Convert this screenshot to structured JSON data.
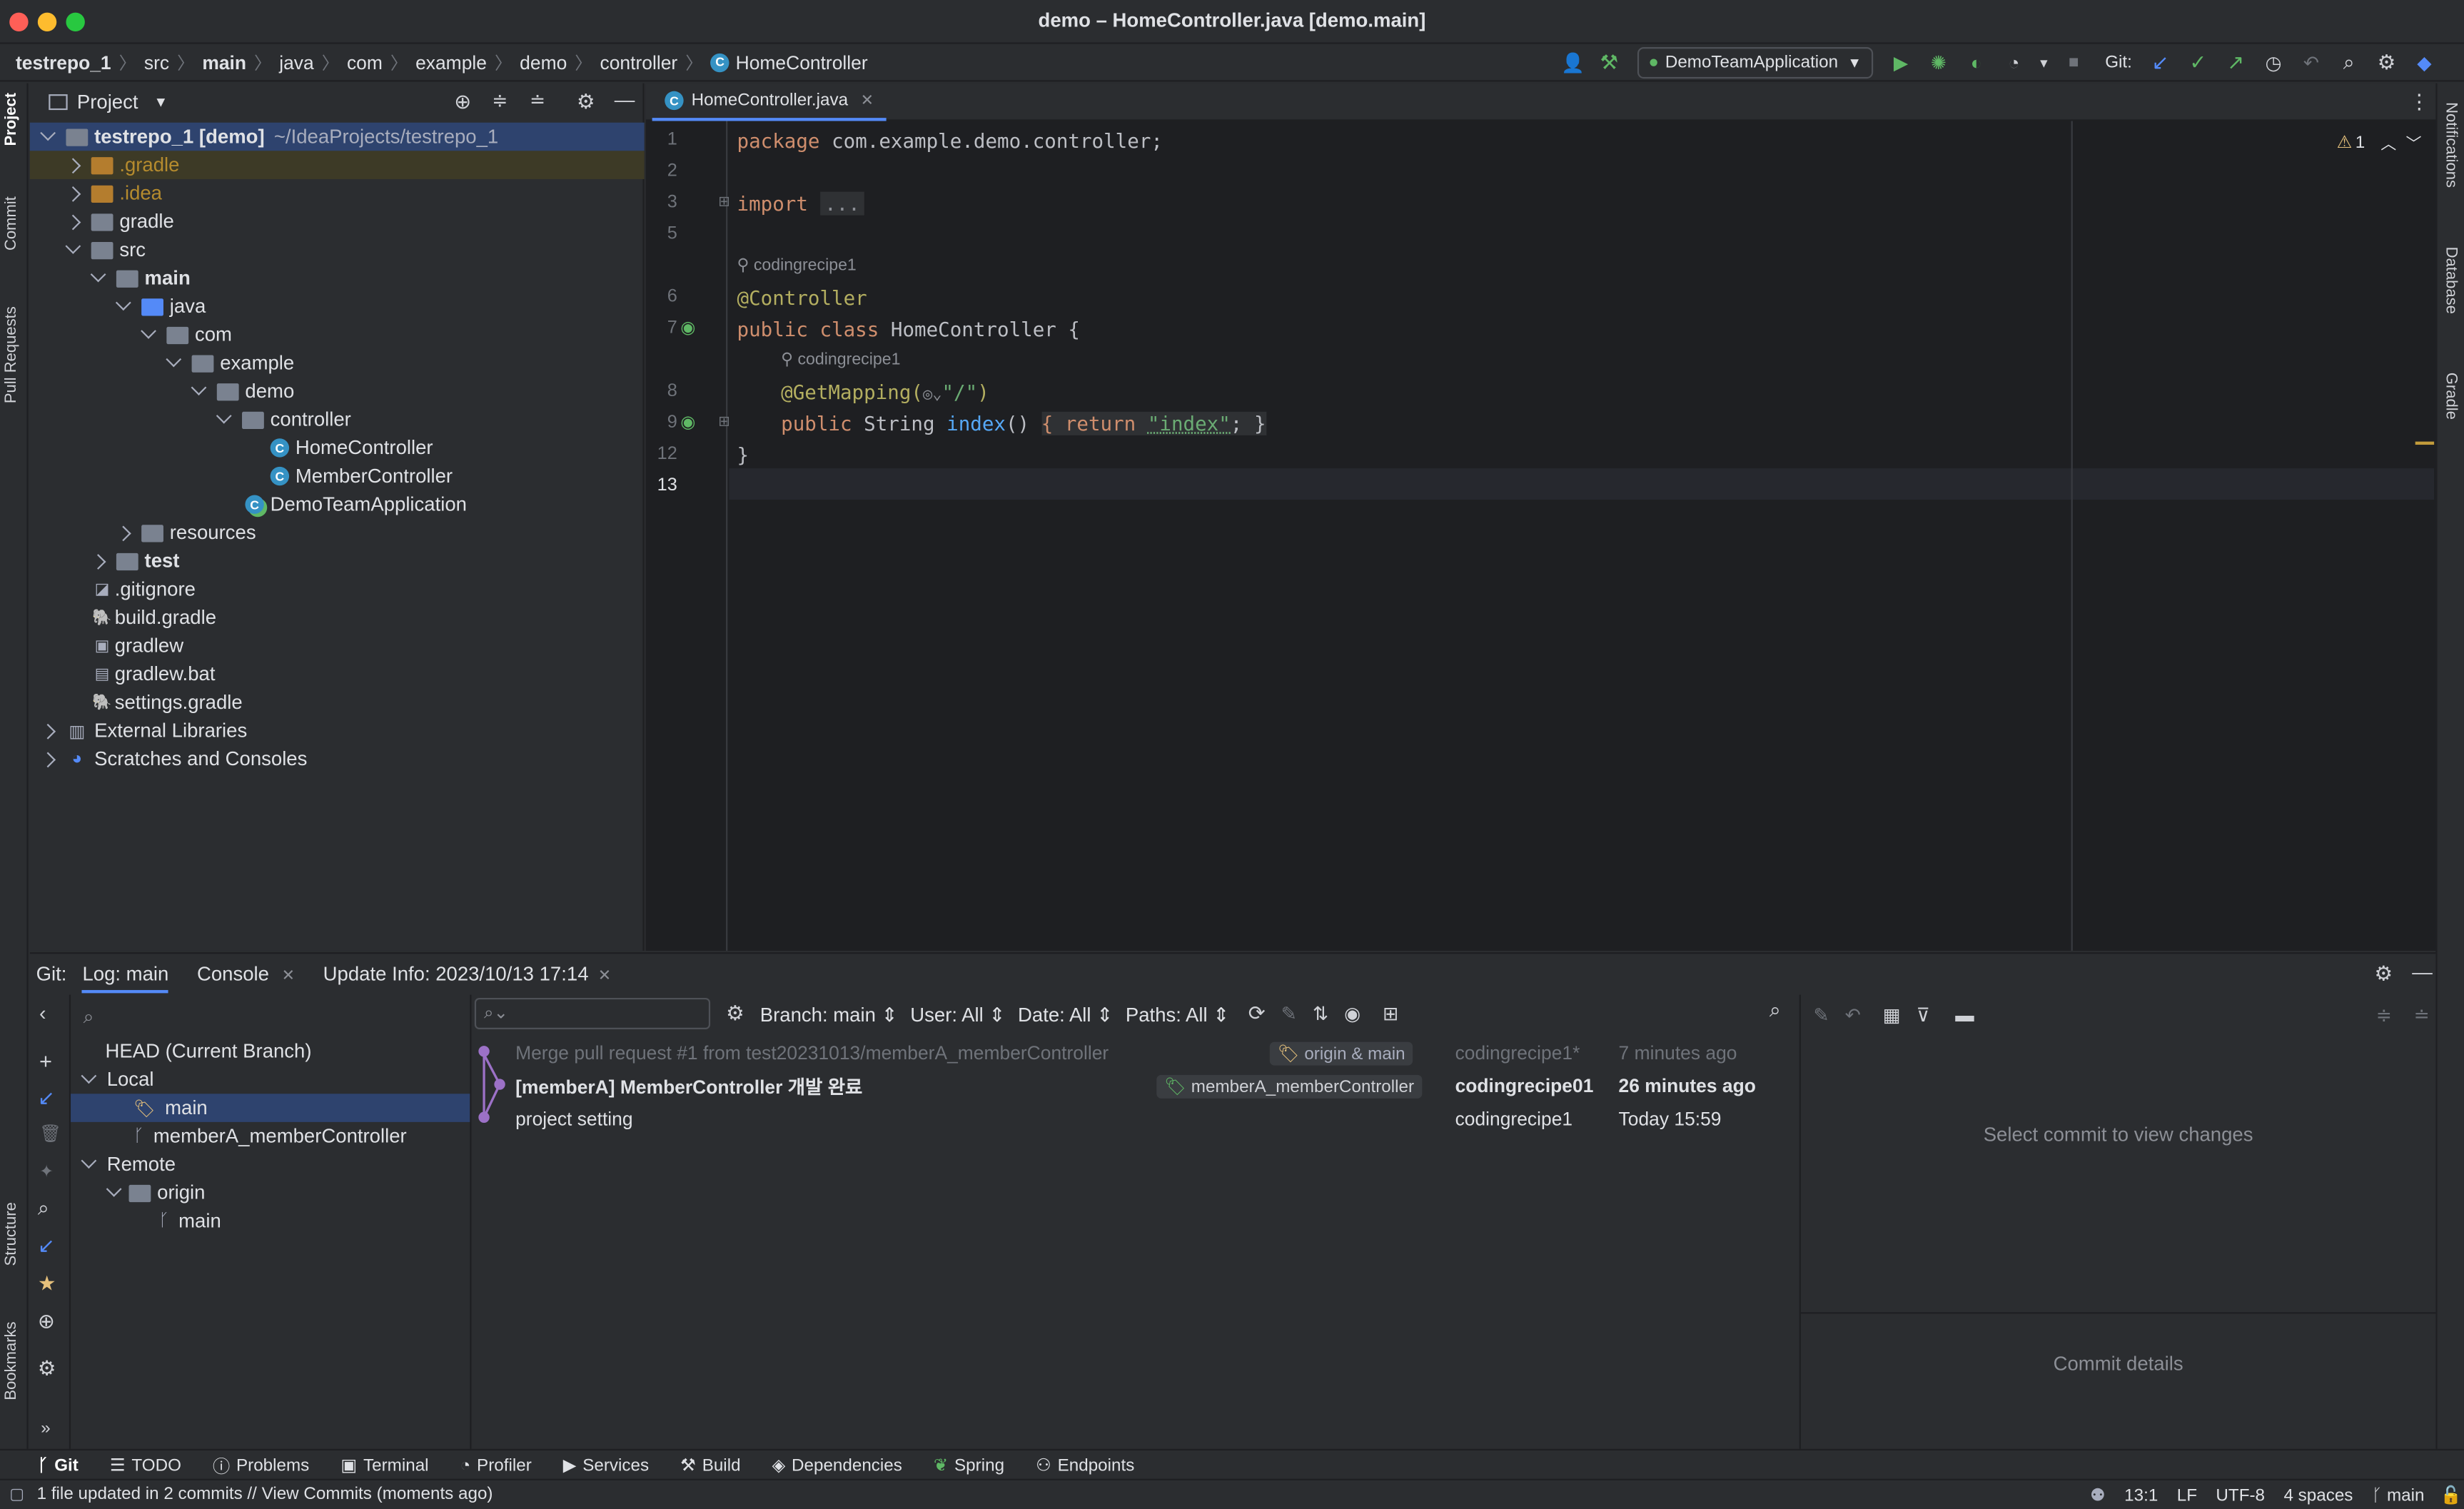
{
  "window": {
    "title": "demo – HomeController.java [demo.main]"
  },
  "breadcrumbs": [
    "testrepo_1",
    "src",
    "main",
    "java",
    "com",
    "example",
    "demo",
    "controller",
    "HomeController"
  ],
  "toolbar": {
    "run_config": "DemoTeamApplication",
    "git_label": "Git:"
  },
  "left_strip": {
    "project": "Project",
    "commit": "Commit",
    "pull_requests": "Pull Requests",
    "structure": "Structure",
    "bookmarks": "Bookmarks"
  },
  "right_strip": {
    "notifications": "Notifications",
    "database": "Database",
    "gradle": "Gradle"
  },
  "project_panel": {
    "title": "Project",
    "tree": [
      {
        "label": "testrepo_1 [demo]",
        "suffix": "~/IdeaProjects/testrepo_1",
        "bold": true
      },
      {
        "label": ".gradle"
      },
      {
        "label": ".idea"
      },
      {
        "label": "gradle"
      },
      {
        "label": "src"
      },
      {
        "label": "main"
      },
      {
        "label": "java"
      },
      {
        "label": "com"
      },
      {
        "label": "example"
      },
      {
        "label": "demo"
      },
      {
        "label": "controller"
      },
      {
        "label": "HomeController"
      },
      {
        "label": "MemberController"
      },
      {
        "label": "DemoTeamApplication"
      },
      {
        "label": "resources"
      },
      {
        "label": "test"
      },
      {
        "label": ".gitignore"
      },
      {
        "label": "build.gradle"
      },
      {
        "label": "gradlew"
      },
      {
        "label": "gradlew.bat"
      },
      {
        "label": "settings.gradle"
      },
      {
        "label": "External Libraries"
      },
      {
        "label": "Scratches and Consoles"
      }
    ]
  },
  "editor": {
    "tab": "HomeController.java",
    "warning_count": "1",
    "line_numbers": [
      "1",
      "2",
      "3",
      "5",
      "6",
      "7",
      "8",
      "9",
      "12",
      "13"
    ],
    "lines": {
      "l1_kw": "package",
      "l1_rest": " com.example.demo.controller;",
      "l3_kw": "import",
      "l3_fold": "...",
      "author1": "codingrecipe1",
      "l6_ann": "@Controller",
      "l7_kw": "public class",
      "l7_rest": " HomeController {",
      "author2": "codingrecipe1",
      "l8_ann": "@GetMapping(",
      "l8_str": "\"/\"",
      "l8_end": ")",
      "l9_kw1": "public",
      "l9_type": " String ",
      "l9_fn": "index",
      "l9_paren": "() ",
      "l9_body_kw": "{ return ",
      "l9_str": "\"index\"",
      "l9_end": "; }",
      "l12": "}"
    }
  },
  "bottom": {
    "git_label": "Git:",
    "tabs": [
      "Log: main",
      "Console",
      "Update Info: 2023/10/13 17:14"
    ],
    "filters": {
      "branch": "Branch: main",
      "user": "User: All",
      "date": "Date: All",
      "paths": "Paths: All"
    },
    "branches": {
      "head": "HEAD (Current Branch)",
      "local": "Local",
      "local_main": "main",
      "local_member": "memberA_memberController",
      "remote": "Remote",
      "origin": "origin",
      "origin_main": "main"
    },
    "commits": [
      {
        "message": "Merge pull request #1 from test20231013/memberA_memberController",
        "tag": "origin & main",
        "author": "codingrecipe1*",
        "date": "7 minutes ago"
      },
      {
        "message": "[memberA] MemberController 개발 완료",
        "tag": "memberA_memberController",
        "author": "codingrecipe01",
        "date": "26 minutes ago"
      },
      {
        "message": "project setting",
        "tag": "",
        "author": "codingrecipe1",
        "date": "Today 15:59"
      }
    ],
    "details": {
      "select_msg": "Select commit to view changes",
      "commit_details": "Commit details"
    }
  },
  "tool_tabs": [
    "Git",
    "TODO",
    "Problems",
    "Terminal",
    "Profiler",
    "Services",
    "Build",
    "Dependencies",
    "Spring",
    "Endpoints"
  ],
  "status": {
    "message": "1 file updated in 2 commits // View Commits (moments ago)",
    "position": "13:1",
    "line_sep": "LF",
    "encoding": "UTF-8",
    "indent": "4 spaces",
    "branch": "main"
  },
  "colors": {
    "accent": "#548af7",
    "selection": "#2e436e",
    "editor_bg": "#1e1f22",
    "panel_bg": "#2b2d30"
  }
}
